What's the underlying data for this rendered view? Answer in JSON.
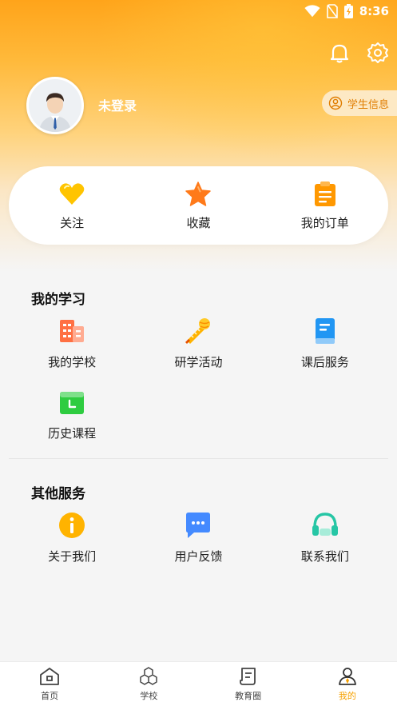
{
  "status_bar": {
    "time": "8:36"
  },
  "profile": {
    "login_label": "未登录",
    "student_info_label": "学生信息"
  },
  "quick_actions": [
    {
      "label": "关注",
      "icon": "heart-icon"
    },
    {
      "label": "收藏",
      "icon": "star-icon"
    },
    {
      "label": "我的订单",
      "icon": "clipboard-icon"
    }
  ],
  "my_study": {
    "title": "我的学习",
    "items": [
      {
        "label": "我的学校",
        "icon": "school-building-icon"
      },
      {
        "label": "研学活动",
        "icon": "bat-ball-icon"
      },
      {
        "label": "课后服务",
        "icon": "book-icon"
      },
      {
        "label": "历史课程",
        "icon": "history-course-icon"
      }
    ]
  },
  "other_services": {
    "title": "其他服务",
    "items": [
      {
        "label": "关于我们",
        "icon": "info-icon"
      },
      {
        "label": "用户反馈",
        "icon": "chat-bubble-icon"
      },
      {
        "label": "联系我们",
        "icon": "headset-icon"
      }
    ]
  },
  "tabbar": [
    {
      "label": "首页",
      "icon": "home-icon",
      "active": false
    },
    {
      "label": "学校",
      "icon": "cubes-icon",
      "active": false
    },
    {
      "label": "教育圈",
      "icon": "scroll-icon",
      "active": false
    },
    {
      "label": "我的",
      "icon": "person-icon",
      "active": true
    }
  ],
  "colors": {
    "accent": "#f6a100",
    "hero_top": "#ffa41a",
    "text": "#222222"
  }
}
